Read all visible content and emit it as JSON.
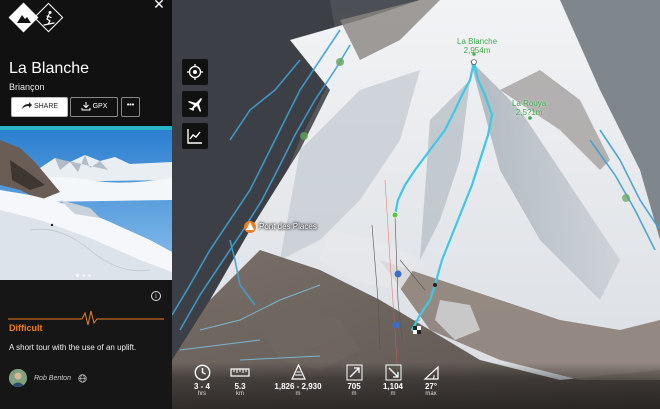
{
  "route": {
    "title": "La Blanche",
    "region": "Briançon",
    "difficulty": "Difficult",
    "description": "A short tour with the use of an uplift.",
    "author": "Rob Benton"
  },
  "actions": {
    "share_label": "SHARE",
    "gpx_label": "GPX",
    "more_label": "•••"
  },
  "map": {
    "labels": [
      {
        "id": "peak-la-blanche",
        "name": "La Blanche",
        "elevation": "2,954m"
      },
      {
        "id": "peak-la-rouya",
        "name": "La Rouya",
        "elevation": "2,5?1m"
      },
      {
        "id": "pont-des-places",
        "name": "Pont des Places"
      }
    ]
  },
  "stats": [
    {
      "icon": "clock-icon",
      "value": "3 - 4",
      "unit": "hrs"
    },
    {
      "icon": "ruler-icon",
      "value": "5.3",
      "unit": "km"
    },
    {
      "icon": "elevation-range-icon",
      "value": "1,826 - 2,930",
      "unit": "m"
    },
    {
      "icon": "ascent-icon",
      "value": "705",
      "unit": "m"
    },
    {
      "icon": "descent-icon",
      "value": "1,104",
      "unit": "m"
    },
    {
      "icon": "slope-icon",
      "value": "27°",
      "unit": "max"
    }
  ],
  "colors": {
    "route": "#3fc8e4",
    "difficulty": "#ec7f1d",
    "accent": "#27b6c9",
    "panel": "#161616"
  }
}
